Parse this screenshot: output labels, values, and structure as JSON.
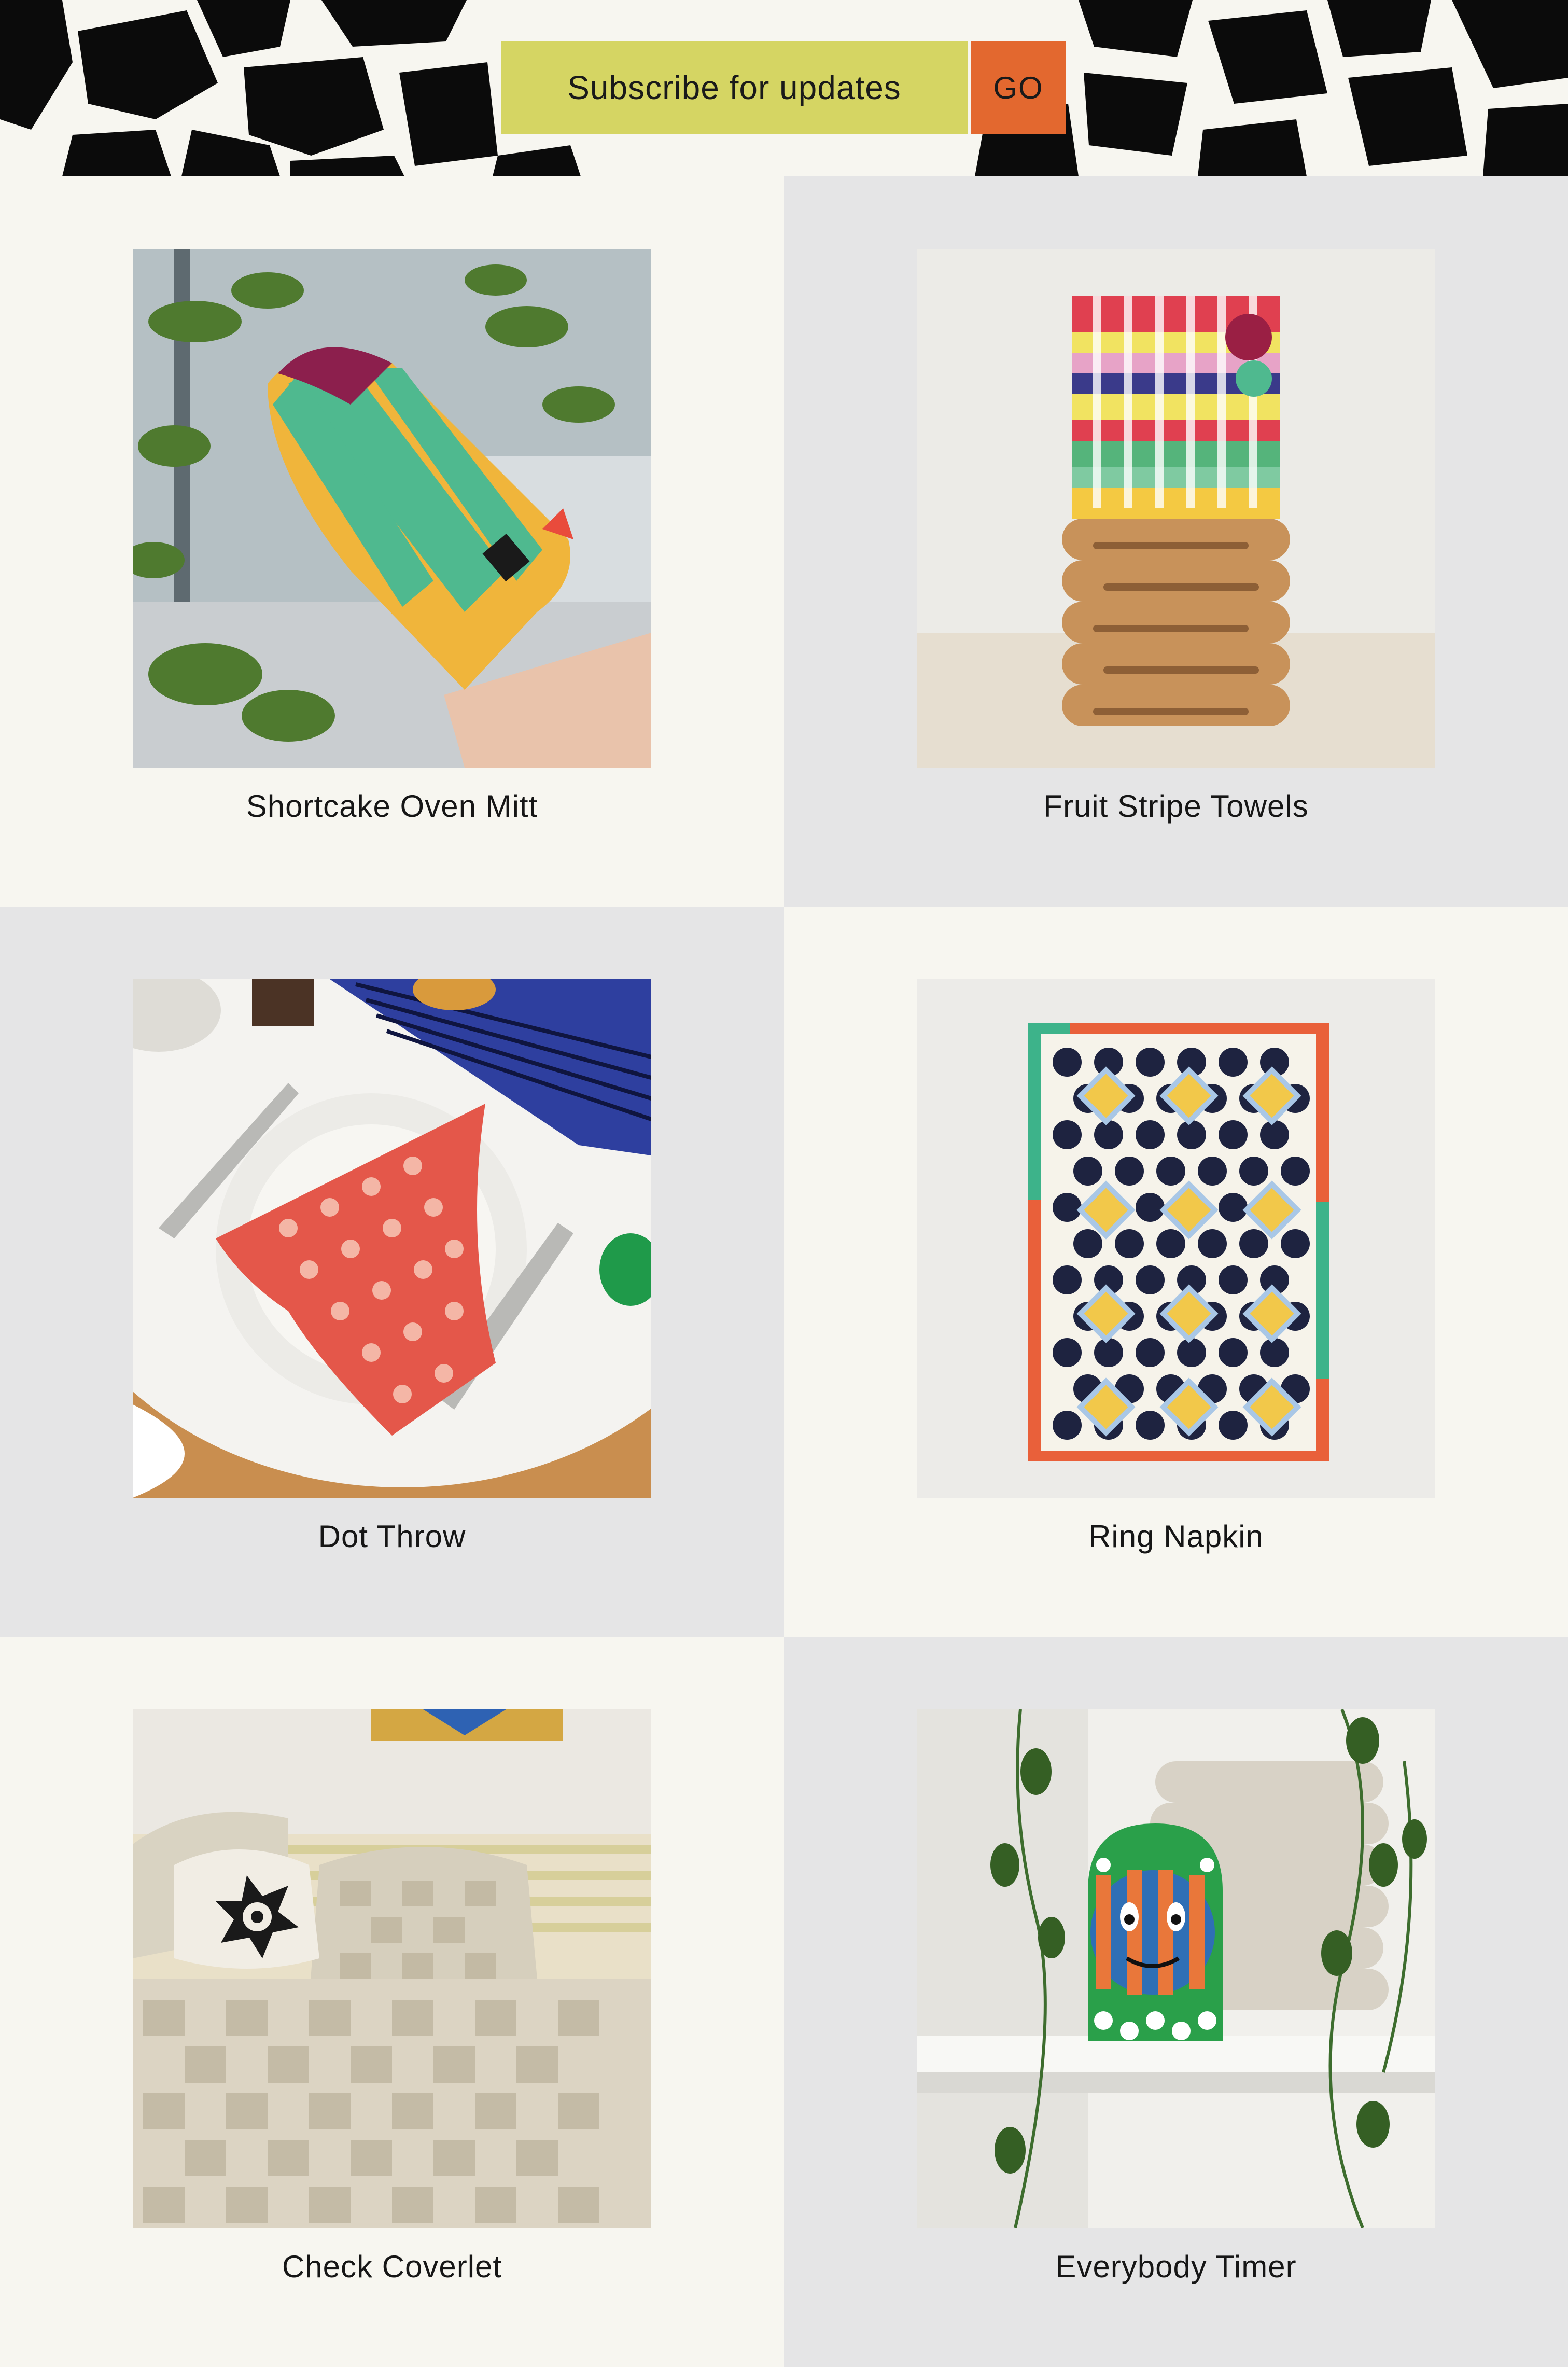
{
  "subscribe": {
    "label": "Subscribe for updates",
    "button": "GO"
  },
  "colors": {
    "background_light": "#f7f6f0",
    "background_gray": "#e5e5e6",
    "subscribe_field": "#d5d563",
    "subscribe_button": "#e3682f",
    "header_pattern": "#0b0b0b"
  },
  "products": [
    {
      "title": "Shortcake Oven Mitt",
      "icon": "oven-mitt-photo"
    },
    {
      "title": "Fruit Stripe Towels",
      "icon": "towels-photo"
    },
    {
      "title": "Dot Throw",
      "icon": "napkin-table-photo"
    },
    {
      "title": "Ring Napkin",
      "icon": "dotted-blanket-photo"
    },
    {
      "title": "Check Coverlet",
      "icon": "bed-coverlet-photo"
    },
    {
      "title": "Everybody Timer",
      "icon": "face-timer-photo"
    }
  ]
}
